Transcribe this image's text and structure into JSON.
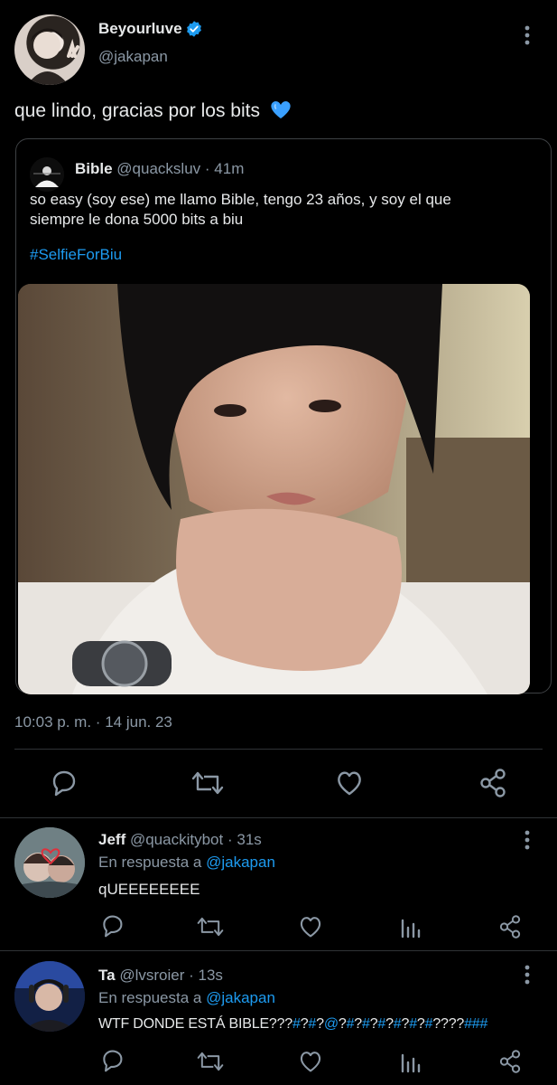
{
  "main_tweet": {
    "display_name": "Beyourluve",
    "handle": "@jakapan",
    "text": "que lindo, gracias por los bits",
    "timestamp": "10:03 p. m.",
    "date": "14 jun. 23",
    "dot": "·"
  },
  "quoted_tweet": {
    "display_name": "Bible",
    "handle": "@quacksluv",
    "time": "41m",
    "dot": "·",
    "text_line1": "so easy (soy ese) me llamo Bible, tengo 23 años, y soy el que",
    "text_line2": "siempre le dona 5000 bits a biu",
    "hashtag": "#SelfieForBiu"
  },
  "replies": [
    {
      "display_name": "Jeff",
      "handle": "@quackitybot",
      "time": "31s",
      "dot": "·",
      "reply_prefix": "En respuesta a",
      "reply_to": "@jakapan",
      "text": "qUEEEEEEEE"
    },
    {
      "display_name": "Ta",
      "handle": "@lvsroier",
      "time": "13s",
      "dot": "·",
      "reply_prefix": "En respuesta a",
      "reply_to": "@jakapan",
      "text_parts": [
        "WTF DONDE ESTÁ BIBLE???",
        "#",
        "?",
        "#",
        "?",
        "@",
        "?",
        "#",
        "?",
        "#",
        "?",
        "#",
        "?",
        "#",
        "?",
        "#",
        "?",
        "#",
        "????",
        "###"
      ]
    }
  ],
  "icons": {
    "verified": "verified-badge-icon",
    "heart_emoji": "blue-heart-emoji",
    "reply": "reply-icon",
    "retweet": "retweet-icon",
    "like": "like-icon",
    "share": "share-icon",
    "views": "views-icon",
    "more": "more-icon"
  },
  "colors": {
    "background": "#000000",
    "text": "#e7e9ea",
    "muted": "#8b98a5",
    "link": "#1d9bf0",
    "verified": "#1d9bf0",
    "heart": "#3aa0ff"
  }
}
